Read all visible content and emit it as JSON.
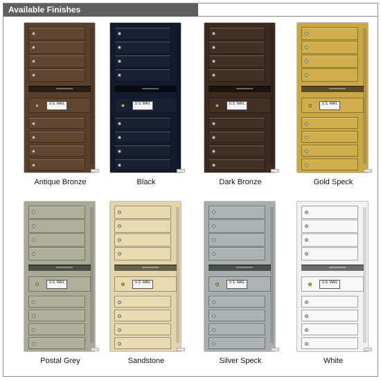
{
  "header": {
    "title": "Available Finishes"
  },
  "finishes": [
    {
      "name": "Antique Bronze",
      "color": "#5a3f2b",
      "plate": "U.S. MAIL"
    },
    {
      "name": "Black",
      "color": "#141a2e",
      "plate": "U.S. MAIL"
    },
    {
      "name": "Dark Bronze",
      "color": "#3b2a1d",
      "plate": "U.S. MAIL"
    },
    {
      "name": "Gold Speck",
      "color": "#c9a845",
      "plate": "U.S. MAIL"
    },
    {
      "name": "Postal Grey",
      "color": "#a9aa95",
      "plate": "U.S. MAIL"
    },
    {
      "name": "Sandstone",
      "color": "#e3d4ab",
      "plate": "U.S. MAIL"
    },
    {
      "name": "Silver Speck",
      "color": "#a7adac",
      "plate": "U.S. MAIL"
    },
    {
      "name": "White",
      "color": "#f2f2f2",
      "plate": "U.S. MAIL"
    }
  ]
}
